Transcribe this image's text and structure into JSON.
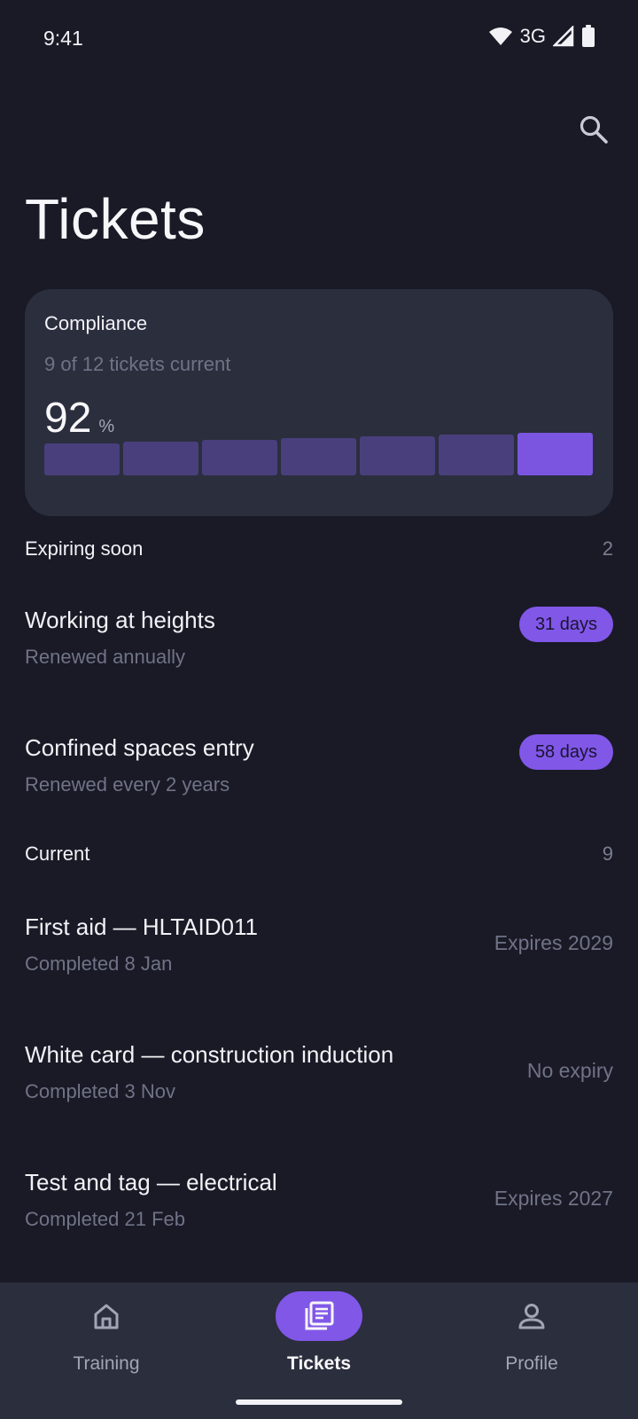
{
  "status_bar": {
    "time": "9:41",
    "network": "3G"
  },
  "header": {
    "title": "Tickets"
  },
  "compliance": {
    "title": "Compliance",
    "subtitle": "9 of 12 tickets current",
    "value": "92",
    "unit": "%",
    "bars": [
      0.75,
      0.79,
      0.83,
      0.87,
      0.91,
      0.95,
      1.0
    ]
  },
  "expiring": {
    "title": "Expiring soon",
    "count": "2",
    "items": [
      {
        "title": "Working at heights",
        "subtitle": "Renewed annually",
        "badge": "31 days"
      },
      {
        "title": "Confined spaces entry",
        "subtitle": "Renewed every 2 years",
        "badge": "58 days"
      }
    ]
  },
  "current": {
    "title": "Current",
    "count": "9",
    "items": [
      {
        "title": "First aid — HLTAID011",
        "subtitle": "Completed 8 Jan",
        "trail": "Expires 2029"
      },
      {
        "title": "White card — construction induction",
        "subtitle": "Completed 3 Nov",
        "trail": "No expiry"
      },
      {
        "title": "Test and tag — electrical",
        "subtitle": "Completed 21 Feb",
        "trail": "Expires 2027"
      }
    ]
  },
  "nav": {
    "training": "Training",
    "tickets": "Tickets",
    "profile": "Profile"
  },
  "colors": {
    "accent": "#8157e8",
    "background": "#191a26",
    "card": "#2b2e3d"
  }
}
